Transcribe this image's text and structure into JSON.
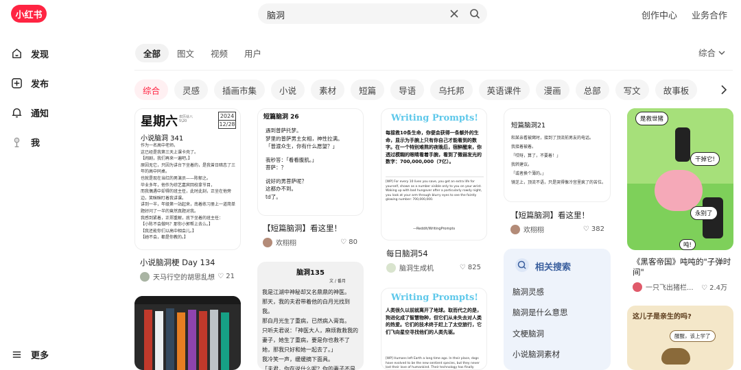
{
  "header": {
    "logo": "小红书",
    "search_value": "脑洞",
    "links": [
      "创作中心",
      "业务合作"
    ]
  },
  "sidebar": {
    "items": [
      {
        "label": "发现",
        "icon": "discover-icon"
      },
      {
        "label": "发布",
        "icon": "publish-icon"
      },
      {
        "label": "通知",
        "icon": "bell-icon"
      },
      {
        "label": "我",
        "icon": "profile-icon"
      }
    ],
    "more": "更多"
  },
  "tabs": [
    "全部",
    "图文",
    "视频",
    "用户"
  ],
  "sort": "综合",
  "chips": [
    "综合",
    "灵感",
    "插画市集",
    "小说",
    "素材",
    "短篇",
    "导语",
    "乌托邦",
    "英语课件",
    "漫画",
    "总部",
    "写文",
    "故事板"
  ],
  "cards": {
    "c1": {
      "title": "小说脑洞梗 Day 134",
      "author": "天马行空的胡思乱想",
      "likes": "21",
      "img": {
        "big": "星期六",
        "sub": "农历廿八 5\\20",
        "year": "2024",
        "date": "12/28",
        "heading": "小说脑洞 341",
        "lines": [
          "作为一名高中老师。",
          "这已经是我第三天上课卡壳了。",
          "【闹剧，我们再来一遍吧。】",
          "原因无它，只因为讲台下坐着的，是我曾日暗恋了三年的高中同桌。",
          "也就是现在当红的男演员——陈郁之。",
          "毕业多年，他作为综艺嘉宾回校拿节目，",
          "而我偶遇中却得的班主任，此时此刻，正坐在他旁边，笑眯眯盯着我讲课。",
          "讲到一半，年级第一站起来，南着练习册上一道简单题好问了一半的竟然真题对我。",
          "我感到紧着，正郑重解，底下坐着的班主任：",
          "【小陈不会做吗？那你小郭帮上去么。】",
          "【我还能你们以高中相会儿。】",
          "【她不会，都是你教的。】"
        ]
      }
    },
    "c2": {
      "title": "【短篇脑洞】看这里！",
      "author": "欢栩栩",
      "likes": "80",
      "img": {
        "heading": "短篇脑洞 26",
        "lines": [
          "遇到普萨托梦。",
          "梦里的普萨男主女相，神性拉满。",
          "「普渡众生，你有什么愿望？」",
          "",
          "我秒答：「看看腹肌。」",
          "菩萨：？",
          "",
          "说好的男菩萨呢？",
          "这都办不到。",
          "td了。"
        ]
      }
    },
    "c3": {
      "img": {
        "title": "脑洞135",
        "byline": "文 / 番月",
        "lines": [
          "我是江湖中神秘却又名鼎鼎的神医。",
          "那天，我的夫君带着他的白月光找到我。",
          "那白月光生了重病，已然病入膏肓。",
          "只听夫君说：「神医大人，麻烦救救我的妻子，她生了重病，要是你也救不了她，那我只好和她一起去了。」",
          "我冷笑一声，缓缓摘下面具。",
          "「夫君，你在说什么呢？你的妻子不是"
        ]
      }
    },
    "c4": {
      "title": "每日脑洞54",
      "author": "脑洞生成机",
      "likes": "825",
      "img": {
        "banner": "Writing Prompts!",
        "zh": "每接救10条生命，你便会获得一条额外的生命，显示为手腕上只有你自己才能看到的数字。在一个特别难熬的夜晚后，宿醉醒来，你透过模糊的眼睛看着手腕，看到了微弱发光的数字：700,000,000（7亿）。",
        "en": "[WP] For every 10 lives you save, you get an extra life for yourself, shown as a number visible only to you on your wrist. Waking up with bad hungover after a particularly rowdy night, you look at your arm through blurry eyes to see the faintly glowing number: 700,000,000.",
        "source": "—Reddit/WritingPrompts"
      }
    },
    "c5": {
      "img": {
        "banner": "Writing Prompts!",
        "zh": "人类很久以前就离开了地球。取而代之的是，狗进化成了智慧物种，但它们从未失去对人类的热爱。它们的技术终于赶上了太空旅行，它们飞向星空寻找他们的人类先驱。",
        "en": "[WP] Humans left Earth a long time ago. In their place, dogs have evolved to be the new sentient species, but they never lost their love of humankind. Their technology has finally caught up to space"
      }
    },
    "c6": {
      "title": "【短篇脑洞】看这里！",
      "author": "欢栩栩",
      "likes": "382",
      "img": {
        "heading": "短篇脑洞21",
        "lines": [
          "和某亲看被窝时，接到了顶流前男友的电话。",
          "我接着被着。",
          "「哎呀，算了，不要着！」",
          "我转建议。",
          "「或者换个薄的。」",
          "镜芝上，顶流不语，只是哭得像冷宫里疯了的苦位。"
        ]
      }
    },
    "c7": {
      "title": "《黑客帝国》吨吨的\"子弹时间\"",
      "author": "一只飞出猪栏...",
      "likes": "2.4万",
      "img": {
        "b1": "是救世猪",
        "b2": "干掉它!",
        "b3": "永别了",
        "b4": "吨!"
      }
    },
    "c8": {
      "img": {
        "title": "这儿子是亲生的吗?",
        "bubble": "醒醒，该上学了"
      }
    }
  },
  "related": {
    "title": "相关搜索",
    "items": [
      "脑洞灵感",
      "脑洞是什么意思",
      "文梗脑洞",
      "小说脑洞素材"
    ]
  },
  "colors": {
    "brand": "#ff2442",
    "related_bg": "#eef3fb"
  }
}
